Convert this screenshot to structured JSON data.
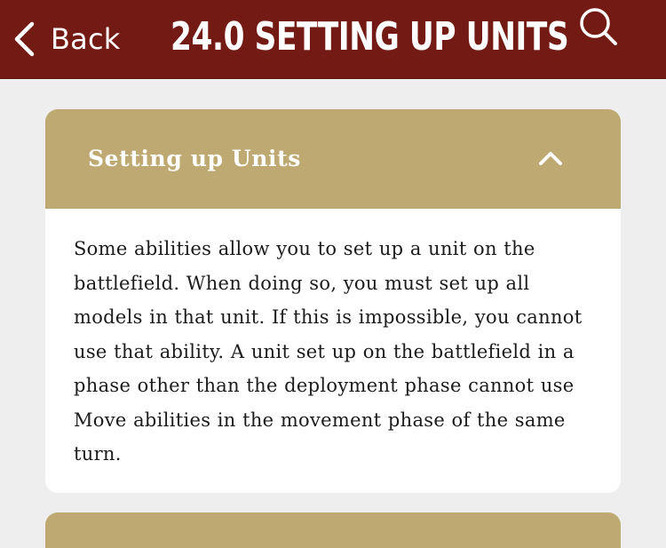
{
  "navbar": {
    "back_label": "Back",
    "title": "24.0 SETTING UP UNITS",
    "back_icon": "chevron-left-icon",
    "search_icon": "search-icon",
    "background_color": "#721a13"
  },
  "section": {
    "title": "Setting up Units",
    "expanded": true,
    "toggle_icon": "chevron-up-icon",
    "header_color": "#bea972",
    "body": "Some abilities allow you to set up a unit on the battlefield. When doing so, you must set up all models in that unit. If this is impossible, you cannot use that ability. A unit set up on the battlefield in a phase other than the deployment phase cannot use Move abilities in the movement phase of the same turn."
  }
}
